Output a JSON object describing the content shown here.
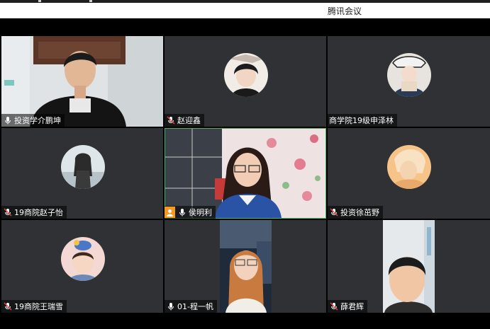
{
  "window": {
    "title": "腾讯会议"
  },
  "participants": [
    {
      "name": "投资学介鹏坤",
      "mic": "on",
      "view": "video"
    },
    {
      "name": "赵迎鑫",
      "mic": "muted",
      "view": "avatar"
    },
    {
      "name": "商学院19级申泽林",
      "mic": "none",
      "view": "avatar"
    },
    {
      "name": "19商院赵子怡",
      "mic": "muted",
      "view": "avatar"
    },
    {
      "name": "侯明利",
      "mic": "on",
      "view": "video",
      "host": true,
      "speaking": true
    },
    {
      "name": "投资徐茁野",
      "mic": "muted",
      "view": "avatar"
    },
    {
      "name": "19商院王瑞雪",
      "mic": "muted",
      "view": "avatar"
    },
    {
      "name": "01-程一帆",
      "mic": "on",
      "view": "video"
    },
    {
      "name": "薛君辉",
      "mic": "muted",
      "view": "video"
    }
  ],
  "colors": {
    "tile_bg": "#2f3134",
    "speaking_border": "#3fb768",
    "host_badge": "#f39a21"
  }
}
